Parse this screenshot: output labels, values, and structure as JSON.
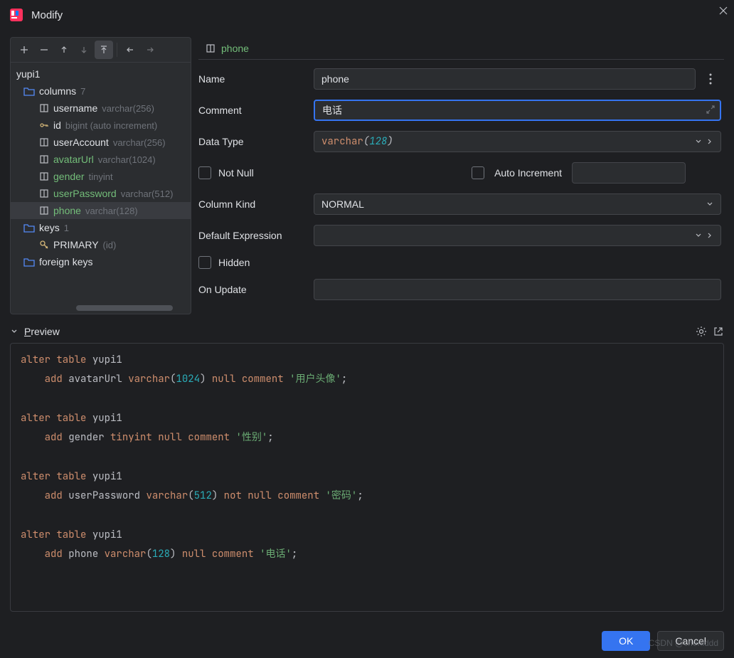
{
  "window": {
    "title": "Modify"
  },
  "tree": {
    "root": "yupi1",
    "columns_label": "columns",
    "columns_count": "7",
    "keys_label": "keys",
    "keys_count": "1",
    "primary_label": "PRIMARY",
    "primary_meta": "(id)",
    "fk_label": "foreign keys",
    "items": [
      {
        "name": "username",
        "meta": "varchar(256)",
        "modified": false,
        "icon": "col"
      },
      {
        "name": "id",
        "meta": "bigint (auto increment)",
        "modified": false,
        "icon": "key"
      },
      {
        "name": "userAccount",
        "meta": "varchar(256)",
        "modified": false,
        "icon": "col"
      },
      {
        "name": "avatarUrl",
        "meta": "varchar(1024)",
        "modified": true,
        "icon": "col"
      },
      {
        "name": "gender",
        "meta": "tinyint",
        "modified": true,
        "icon": "col"
      },
      {
        "name": "userPassword",
        "meta": "varchar(512)",
        "modified": true,
        "icon": "col"
      },
      {
        "name": "phone",
        "meta": "varchar(128)",
        "modified": true,
        "icon": "col",
        "selected": true
      }
    ]
  },
  "crumb": {
    "label": "phone"
  },
  "form": {
    "name_label": "Name",
    "name_value": "phone",
    "comment_label": "Comment",
    "comment_value": "电话",
    "datatype_label": "Data Type",
    "datatype_kw": "varchar",
    "datatype_open": "(",
    "datatype_num": "128",
    "datatype_close": ")",
    "not_null_label": "Not Null",
    "auto_inc_label": "Auto Increment",
    "column_kind_label": "Column Kind",
    "column_kind_value": "NORMAL",
    "default_expr_label": "Default Expression",
    "default_expr_value": "",
    "hidden_label": "Hidden",
    "on_update_label": "On Update",
    "on_update_value": ""
  },
  "preview": {
    "label_pre": "P",
    "label_rest": "review"
  },
  "sql": {
    "kw_alter": "alter",
    "kw_table": "table",
    "kw_add": "add",
    "kw_varchar": "varchar",
    "kw_tinyint": "tinyint",
    "kw_null": "null",
    "kw_not": "not",
    "kw_comment": "comment",
    "tbl": "yupi1",
    "s1_col": "avatarUrl",
    "s1_num": "1024",
    "s1_str": "'用户头像'",
    "s2_col": "gender",
    "s2_str": "'性别'",
    "s3_col": "userPassword",
    "s3_num": "512",
    "s3_str": "'密码'",
    "s4_col": "phone",
    "s4_num": "128",
    "s4_str": "'电话'"
  },
  "buttons": {
    "ok": "OK",
    "cancel": "Cancel"
  },
  "watermark": "CSDN @chenlddd"
}
